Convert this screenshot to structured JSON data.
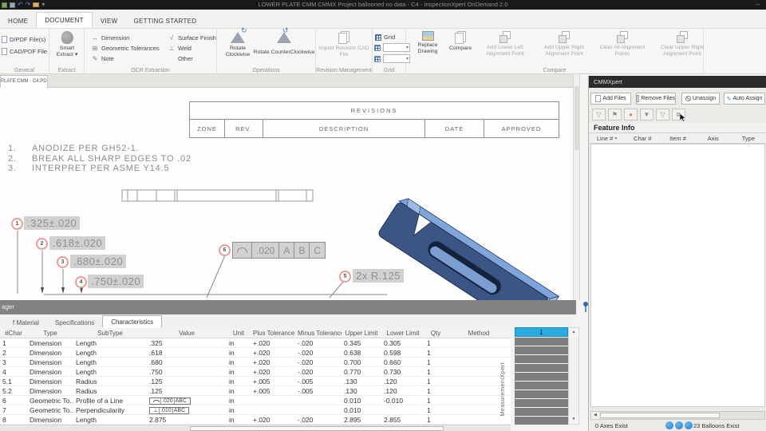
{
  "colors": {
    "accent_blue": "#29abe2",
    "balloon_stroke": "#e89e97",
    "highlight_gray": "#d2d1cf",
    "part_dark_blue": "#3b5584",
    "part_light_blue": "#8fb0de",
    "titlebar_bg": "#191919"
  },
  "titlebar": {
    "title": "LOWER PLATE CMM CMMX Project ballooned no data - C4 - InspectionXpert OnDemand 2.0",
    "minimize_glyph": "–"
  },
  "ribbon_tabs": [
    {
      "label": "HOME",
      "active": false
    },
    {
      "label": "DOCUMENT",
      "active": true
    },
    {
      "label": "VIEW",
      "active": false
    },
    {
      "label": "GETTING STARTED",
      "active": false
    }
  ],
  "ribbon": {
    "general": {
      "label": "General",
      "item1": "D/PDF File(s)",
      "item2": "CAD/PDF File"
    },
    "extract": {
      "label": "Extract",
      "button": "Smart Extract",
      "dropdown_glyph": "▾"
    },
    "ocr": {
      "label": "OCR Extraction",
      "items": [
        "Dimension",
        "Geometric Tolerances",
        "Note",
        "Surface Finish",
        "Weld",
        "Other"
      ]
    },
    "operations": {
      "label": "Operations",
      "rotate_cw": "Rotate Clockwise",
      "rotate_ccw": "Rotate CounterClockwise"
    },
    "revision": {
      "label": "Revision Management",
      "import_button": "Import Revision CAD File"
    },
    "grid": {
      "label": "Grid",
      "checkbox_label": "Grid"
    },
    "compare": {
      "label": "Compare",
      "items": [
        "Replace Drawing",
        "Compare",
        "Add Lower Left Alignment Point",
        "Add Upper Right Alignment Point",
        "Clear All Alignment Points",
        "Clear Upper Right Alignment Point"
      ]
    }
  },
  "document_tab": {
    "label": "PLATE CMM - C4.PDF"
  },
  "drawing": {
    "revisions": {
      "title": "REVISIONS",
      "columns": [
        "ZONE",
        "REV.",
        "DESCRIPTION",
        "DATE",
        "APPROVED"
      ]
    },
    "notes": [
      {
        "num": "1.",
        "text": "ANODIZE PER GH52-1."
      },
      {
        "num": "2.",
        "text": "BREAK ALL SHARP EDGES TO .02"
      },
      {
        "num": "3.",
        "text": "INTERPRET PER ASME Y14.5"
      }
    ],
    "balloons": {
      "b1": {
        "num": "1",
        "label": ".325±.020"
      },
      "b2": {
        "num": "2",
        "label": ".618±.020"
      },
      "b3": {
        "num": "3",
        "label": ".680±.020"
      },
      "b4": {
        "num": "4",
        "label": ".750±.020"
      },
      "b5": {
        "num": "5",
        "label": "2x R.125"
      },
      "b6": {
        "num": "6"
      }
    },
    "fcf": {
      "tolerance": ".020",
      "datum_a": "A",
      "datum_b": "B",
      "datum_c": "C"
    }
  },
  "bottom_panel": {
    "title": "ager",
    "tabs": [
      {
        "label": "f Material",
        "active": false
      },
      {
        "label": "Specifications",
        "active": false
      },
      {
        "label": "Characteristics",
        "active": true
      }
    ],
    "table": {
      "columns": [
        "#Char",
        "Type",
        "SubType",
        "Value",
        "Unit",
        "Plus Tolerance",
        "Minus Tolerance",
        "Upper Limit",
        "Lower Limit",
        "Qty",
        "Method"
      ],
      "rows": [
        {
          "cells": [
            "1",
            "Dimension",
            "Length",
            ".325",
            "in",
            "+.020",
            "-.020",
            "0.345",
            "0.305",
            "1",
            ""
          ]
        },
        {
          "cells": [
            "2",
            "Dimension",
            "Length",
            ".618",
            "in",
            "+.020",
            "-.020",
            "0.638",
            "0.598",
            "1",
            ""
          ]
        },
        {
          "cells": [
            "3",
            "Dimension",
            "Length",
            ".680",
            "in",
            "+.020",
            "-.020",
            "0.700",
            "0.660",
            "1",
            ""
          ]
        },
        {
          "cells": [
            "4",
            "Dimension",
            "Length",
            ".750",
            "in",
            "+.020",
            "-.020",
            "0.770",
            "0.730",
            "1",
            ""
          ]
        },
        {
          "cells": [
            "5.1",
            "Dimension",
            "Radius",
            ".125",
            "in",
            "+.005",
            "-.005",
            ".130",
            ".120",
            "1",
            ""
          ]
        },
        {
          "cells": [
            "5.2",
            "Dimension",
            "Radius",
            ".125",
            "in",
            "+.005",
            "-.005",
            ".130",
            ".120",
            "1",
            ""
          ]
        },
        {
          "cells": [
            "6",
            "Geometric To...",
            "Profile of a Line",
            "",
            "in",
            "",
            "",
            "0.010",
            "-0.010",
            "1",
            ""
          ],
          "fcf": {
            "symbol": "profile",
            "value": ".020",
            "datums": "ABC"
          }
        },
        {
          "cells": [
            "7",
            "Geometric To...",
            "Perpendicularity",
            "",
            "in",
            "",
            "",
            "0.010",
            "",
            "1",
            ""
          ],
          "fcf": {
            "symbol": "perpendicularity",
            "value": ".010",
            "datums": "ABC"
          }
        },
        {
          "cells": [
            "8",
            "Dimension",
            "Length",
            "2.875",
            "in",
            "+.020",
            "-.020",
            "2.895",
            "2.855",
            "1",
            ""
          ]
        }
      ]
    },
    "result_grid": {
      "header": "1",
      "empty_rows": 10
    },
    "side_tab": "MeasurementXpert"
  },
  "right_panel": {
    "title": "CMMXpert",
    "buttons": [
      "Add Files",
      "Remove Files",
      "Unassign",
      "Auto Assign"
    ],
    "feature_info": {
      "title": "Feature Info",
      "columns": [
        "Line #",
        "Char #",
        "Item #",
        "Axis",
        "Type"
      ]
    },
    "status": {
      "left": "0 Axes Exist",
      "right": "23 Balloons Exist"
    }
  }
}
